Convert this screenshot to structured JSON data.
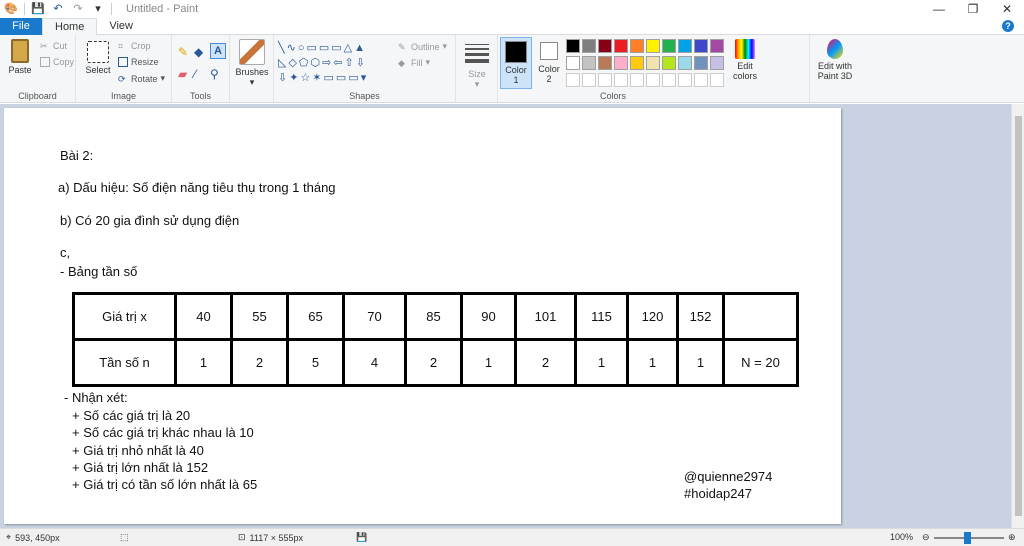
{
  "app": {
    "title": "Untitled - Paint"
  },
  "tabs": [
    {
      "label": "File"
    },
    {
      "label": "Home"
    },
    {
      "label": "View"
    }
  ],
  "clipboard": {
    "paste": "Paste",
    "cut": "Cut",
    "copy": "Copy",
    "label": "Clipboard"
  },
  "image": {
    "select": "Select",
    "crop": "Crop",
    "resize": "Resize",
    "rotate": "Rotate",
    "label": "Image"
  },
  "tools": {
    "label": "Tools"
  },
  "brushes": {
    "label": "Brushes"
  },
  "shapes": {
    "outline": "Outline",
    "fill": "Fill",
    "label": "Shapes"
  },
  "size": {
    "label": "Size"
  },
  "colors": {
    "color1": "Color",
    "color1_num": "1",
    "color2": "Color",
    "color2_num": "2",
    "label": "Colors",
    "edit_colors": "Edit",
    "edit_colors2": "colors",
    "paint3d": "Edit with",
    "paint3d2": "Paint 3D"
  },
  "palette": [
    "#000000",
    "#7f7f7f",
    "#880015",
    "#ed1c24",
    "#ff7f27",
    "#fff200",
    "#22b14c",
    "#00a2e8",
    "#3f48cc",
    "#a349a4",
    "#ffffff",
    "#c3c3c3",
    "#b97a57",
    "#ffaec9",
    "#ffc90e",
    "#efe4b0",
    "#b5e61d",
    "#99d9ea",
    "#7092be",
    "#c8bfe7"
  ],
  "doc": {
    "l1": "Bài 2:",
    "l2": "a) Dấu hiệu: Số điện năng tiêu thụ trong 1 tháng",
    "l3": "b) Có 20 gia đình sử dụng điện",
    "l4": "c,",
    "l5": "- Bảng tần số",
    "row1_head": "Giá trị x",
    "row2_head": "Tần số n",
    "values": [
      "40",
      "55",
      "65",
      "70",
      "85",
      "90",
      "101",
      "115",
      "120",
      "152"
    ],
    "freqs": [
      "1",
      "2",
      "5",
      "4",
      "2",
      "1",
      "2",
      "1",
      "1",
      "1"
    ],
    "total": "N = 20",
    "n1": "- Nhận xét:",
    "n2": "+ Số các giá trị là 20",
    "n3": "+ Số các giá trị khác nhau là 10",
    "n4": "+ Giá trị nhỏ nhất là 40",
    "n5": "+ Giá trị lớn nhất là 152",
    "n6": "+ Giá trị có tần số lớn nhất là 65",
    "sig1": "@quienne2974",
    "sig2": "#hoidap247"
  },
  "status": {
    "cursor": "593, 450px",
    "size": "1117 × 555px",
    "zoom": "100%"
  }
}
